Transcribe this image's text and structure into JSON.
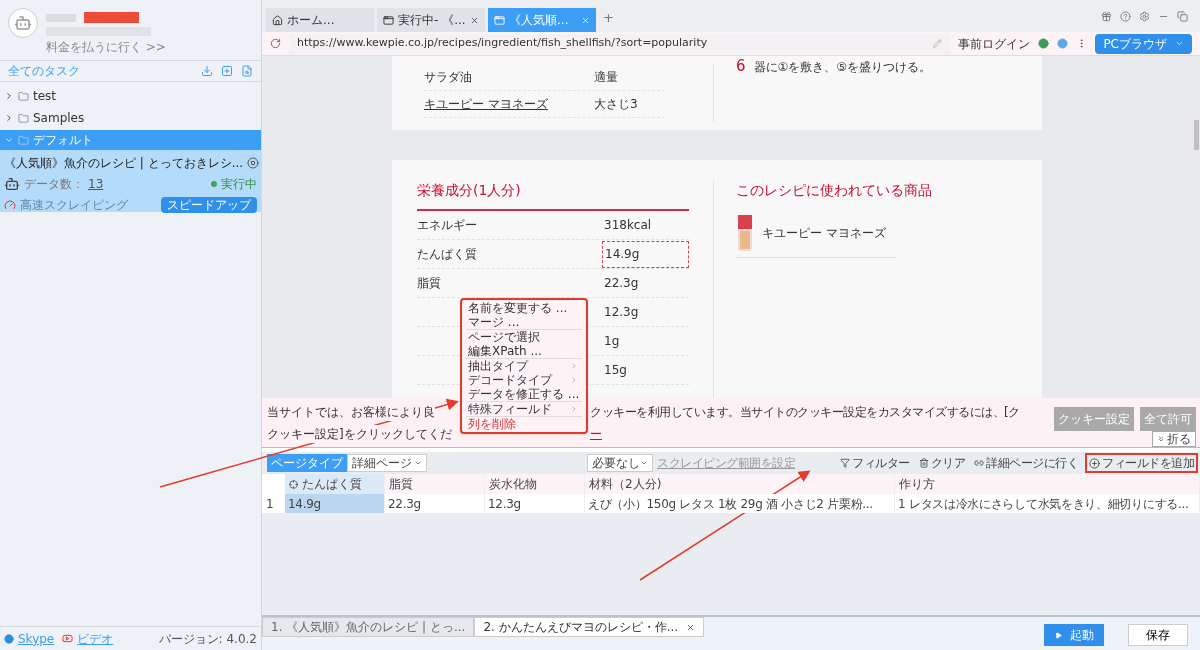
{
  "sidebar": {
    "pay_link": "料金を払うに行く >>",
    "all_tasks": "全てのタスク",
    "tree": [
      {
        "label": "test",
        "expanded": false,
        "selected": false
      },
      {
        "label": "Samples",
        "expanded": false,
        "selected": false
      },
      {
        "label": "デフォルト",
        "expanded": true,
        "selected": true,
        "children": [
          {
            "title": "《人気順》魚介のレシピ | とっておきレシ...",
            "count_label": "データ数：",
            "count": "13",
            "status": "実行中",
            "mode": "高速スクレイピング",
            "boost_button": "スピードアップ"
          }
        ]
      }
    ],
    "footer": {
      "skype": "Skype",
      "video": "ビデオ",
      "version": "バージョン: 4.0.2"
    }
  },
  "browser_tabs": [
    {
      "label": "ホーム...",
      "kind": "home",
      "selected": false
    },
    {
      "label": "実行中- 《...",
      "kind": "page",
      "selected": false
    },
    {
      "label": "《人気順...",
      "kind": "page",
      "selected": true
    }
  ],
  "new_tab": "+",
  "address_bar": {
    "url": "https://www.kewpie.co.jp/recipes/ingredient/fish_shellfish/?sort=popularity",
    "login": "事前ログイン",
    "browser_mode": "PCブラウザ"
  },
  "web_page": {
    "ingredients": [
      {
        "name": "サラダ油",
        "amount": "適量",
        "link": false
      },
      {
        "name": "キユーピー マヨネーズ",
        "amount": "大さじ3",
        "link": true
      }
    ],
    "step": {
      "number": "6",
      "text": "器に①を敷き、⑤を盛りつける。"
    },
    "nutrition": {
      "title": "栄養成分(1人分)",
      "rows": [
        {
          "label": "エネルギー",
          "value": "318kcal",
          "selected": false
        },
        {
          "label": "たんぱく質",
          "value": "14.9g",
          "selected": true
        },
        {
          "label": "脂質",
          "value": "22.3g",
          "selected": false
        },
        {
          "value": "12.3g",
          "selected": false
        },
        {
          "value": "1g",
          "selected": false
        },
        {
          "value": "15g",
          "selected": false
        }
      ]
    },
    "products": {
      "title": "このレシピに使われている商品",
      "items": [
        {
          "name": "キユーピー マヨネーズ",
          "kind": "picture"
        }
      ]
    }
  },
  "cookie_banner": {
    "text_left": "当サイトでは、お客様により良",
    "text_right": "クッキーを利用しています。当サイトのクッキー設定をカスタマイズするには、[ク",
    "line2_left": "クッキー設定]をクリックしてくだ",
    "line2_link": "ー",
    "buttons": [
      "クッキー設定",
      "全て許可"
    ],
    "collapse": "折る"
  },
  "toolbar": {
    "page_type_label": "ページタイプ",
    "page_type": "詳細ページ",
    "second_select": "必要なし",
    "range_link": "スクレイピング範囲を設定",
    "actions": [
      {
        "label": "フィルター",
        "kind": "filter",
        "annotated": false
      },
      {
        "label": "クリア",
        "kind": "clear",
        "annotated": false
      },
      {
        "label": "詳細ページに行く",
        "kind": "link",
        "annotated": false
      },
      {
        "label": "フィールドを追加",
        "kind": "add",
        "annotated": true
      }
    ]
  },
  "table": {
    "columns": [
      {
        "label": "たんぱく質",
        "selected": true
      },
      {
        "label": "脂質",
        "selected": false
      },
      {
        "label": "炭水化物",
        "selected": false
      },
      {
        "label": "材料（2人分)",
        "selected": false
      },
      {
        "label": "作り方",
        "selected": false
      }
    ],
    "rows": [
      {
        "index": "1",
        "cells": [
          "14.9g",
          "22.3g",
          "12.3g",
          "えび（小）150g レタス 1枚 29g 酒 小さじ2 片栗粉...",
          "1 レタスは冷水にさらして水気をきり、細切りにする..."
        ]
      }
    ]
  },
  "context_menu": {
    "groups": [
      [
        {
          "label": "名前を変更する ...",
          "kind": "action"
        },
        {
          "label": "マージ ...",
          "kind": "action"
        }
      ],
      [
        {
          "label": "ページで選択",
          "kind": "action"
        },
        {
          "label": "編集XPath ...",
          "kind": "action"
        }
      ],
      [
        {
          "label": "抽出タイプ",
          "kind": "submenu"
        },
        {
          "label": "デコードタイプ",
          "kind": "submenu"
        },
        {
          "label": "データを修正する ...",
          "kind": "action"
        }
      ],
      [
        {
          "label": "特殊フィールド",
          "kind": "submenu"
        }
      ],
      [
        {
          "label": "列を削除",
          "kind": "danger"
        }
      ]
    ]
  },
  "run_tabs": [
    {
      "label": "1. 《人気順》魚介のレシピ | とっ...",
      "selected": false
    },
    {
      "label": "2. かんたんえびマヨのレシピ・作...",
      "selected": true
    }
  ],
  "run_buttons": {
    "start": "起動",
    "save": "保存"
  }
}
